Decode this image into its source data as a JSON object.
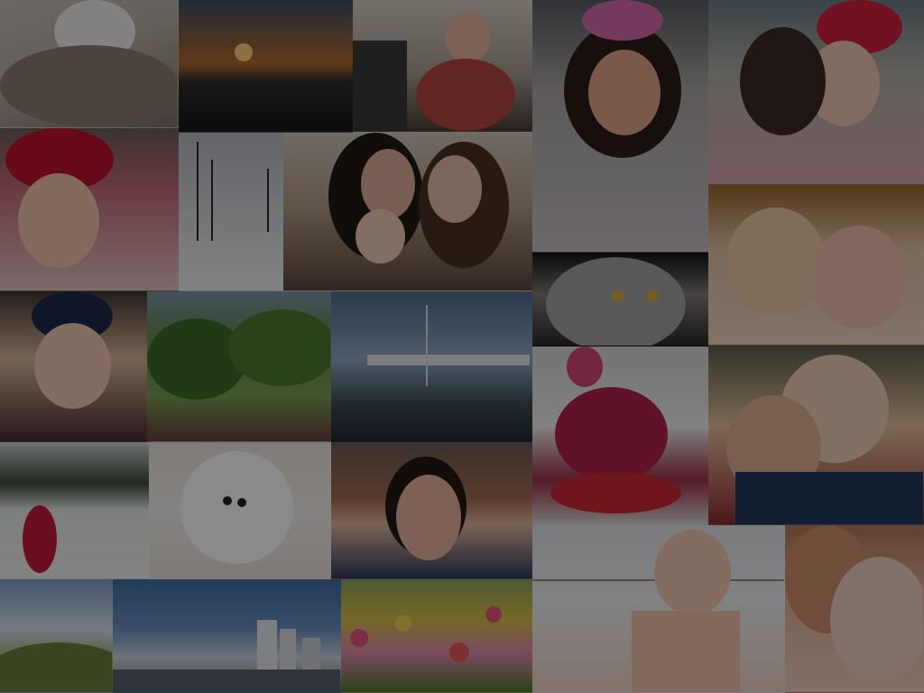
{
  "screen": {
    "type": "photo-mosaic-background"
  },
  "tiles": [
    {
      "name": "cat-in-bed-photo"
    },
    {
      "name": "sunset-over-water-photo"
    },
    {
      "name": "baby-drinking-bottle-photo"
    },
    {
      "name": "smiling-girl-curly-hair-photo"
    },
    {
      "name": "girl-in-red-cap-with-woman-photo"
    },
    {
      "name": "girl-in-minnie-cap-photo"
    },
    {
      "name": "snowy-trees-photo"
    },
    {
      "name": "two-women-with-baby-photo"
    },
    {
      "name": "persian-cat-closeup-photo"
    },
    {
      "name": "two-children-faces-photo"
    },
    {
      "name": "toddler-in-knit-hat-photo"
    },
    {
      "name": "park-garden-photo"
    },
    {
      "name": "marina-boats-photo"
    },
    {
      "name": "child-sledding-in-snow-photo"
    },
    {
      "name": "brother-and-sister-photo"
    },
    {
      "name": "child-in-snow-field-photo"
    },
    {
      "name": "white-puppy-photo"
    },
    {
      "name": "girl-smiling-indoors-photo"
    },
    {
      "name": "baby-with-bunting-photo"
    },
    {
      "name": "mother-kissing-baby-photo"
    },
    {
      "name": "hillside-landscape-photo"
    },
    {
      "name": "city-skyline-photo"
    },
    {
      "name": "wildflowers-photo"
    }
  ]
}
